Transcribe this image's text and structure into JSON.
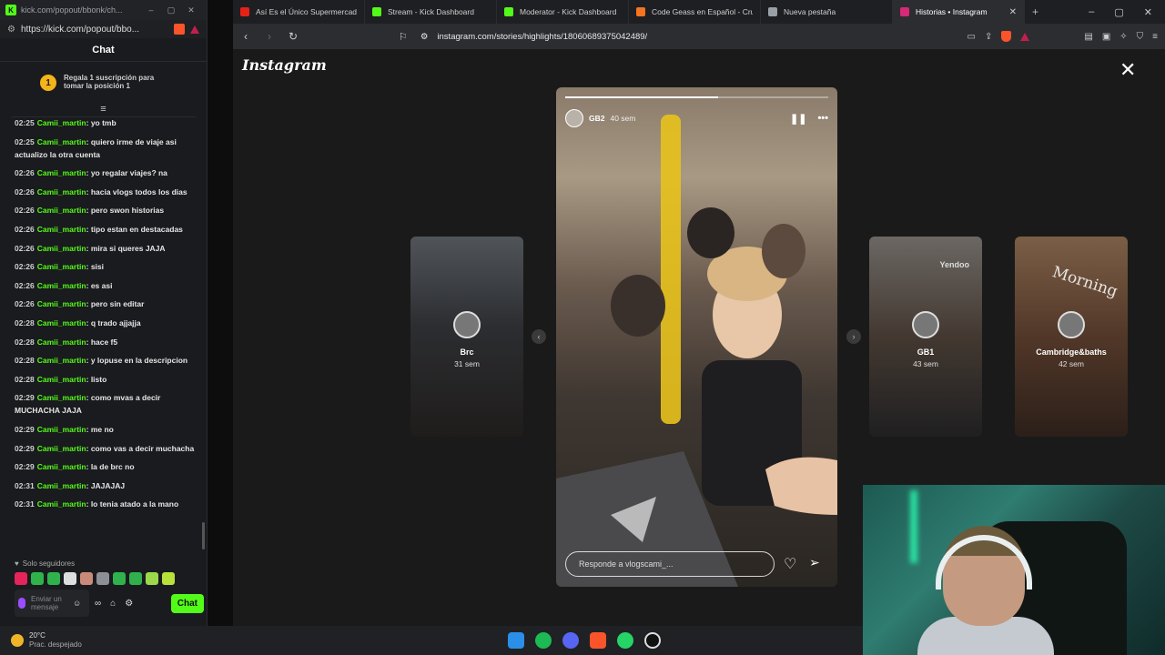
{
  "chat_window": {
    "title": "kick.com/popout/bbonk/ch...",
    "url": "https://kick.com/popout/bbo...",
    "header": "Chat",
    "promo": {
      "badge": "1",
      "text": "Regala 1 suscripción para tomar la posición 1"
    },
    "messages": [
      {
        "time": "02:25",
        "user": "Camii_martin",
        "text": "yo tmb"
      },
      {
        "time": "02:25",
        "user": "Camii_martin",
        "text": "quiero irme de viaje asi actualizo la otra cuenta"
      },
      {
        "time": "02:26",
        "user": "Camii_martin",
        "text": "yo regalar viajes? na"
      },
      {
        "time": "02:26",
        "user": "Camii_martin",
        "text": "hacia vlogs todos los dias"
      },
      {
        "time": "02:26",
        "user": "Camii_martin",
        "text": "pero swon historias"
      },
      {
        "time": "02:26",
        "user": "Camii_martin",
        "text": "tipo estan en destacadas"
      },
      {
        "time": "02:26",
        "user": "Camii_martin",
        "text": "mira si queres JAJA"
      },
      {
        "time": "02:26",
        "user": "Camii_martin",
        "text": "sisi"
      },
      {
        "time": "02:26",
        "user": "Camii_martin",
        "text": "es asi"
      },
      {
        "time": "02:26",
        "user": "Camii_martin",
        "text": "pero sin editar"
      },
      {
        "time": "02:28",
        "user": "Camii_martin",
        "text": "q trado ajjajja"
      },
      {
        "time": "02:28",
        "user": "Camii_martin",
        "text": "hace f5"
      },
      {
        "time": "02:28",
        "user": "Camii_martin",
        "text": "y lopuse en la descripcion"
      },
      {
        "time": "02:28",
        "user": "Camii_martin",
        "text": "listo"
      },
      {
        "time": "02:29",
        "user": "Camii_martin",
        "text": "como mvas a decir MUCHACHA JAJA"
      },
      {
        "time": "02:29",
        "user": "Camii_martin",
        "text": "me no"
      },
      {
        "time": "02:29",
        "user": "Camii_martin",
        "text": "como vas a decir muchacha"
      },
      {
        "time": "02:29",
        "user": "Camii_martin",
        "text": "la de brc no"
      },
      {
        "time": "02:31",
        "user": "Camii_martin",
        "text": "JAJAJAJ"
      },
      {
        "time": "02:31",
        "user": "Camii_martin",
        "text": "lo tenia atado a la mano"
      }
    ],
    "followers_only": "Solo seguidores",
    "input_placeholder": "Enviar un mensaje",
    "chat_button": "Chat"
  },
  "browser": {
    "tabs": [
      {
        "label": "Así Es el Único Supermercado P",
        "icon_color": "#e62117",
        "active": false
      },
      {
        "label": "Stream - Kick Dashboard",
        "icon_color": "#53fc18",
        "active": false
      },
      {
        "label": "Moderator - Kick Dashboard",
        "icon_color": "#53fc18",
        "active": false
      },
      {
        "label": "Code Geass en Español - Crunc",
        "icon_color": "#f47521",
        "active": false
      },
      {
        "label": "Nueva pestaña",
        "icon_color": "#9aa0a6",
        "active": false
      },
      {
        "label": "Historias • Instagram",
        "icon_color": "#d62976",
        "active": true
      }
    ],
    "url": "instagram.com/stories/highlights/18060689375042489/"
  },
  "instagram": {
    "logo": "Instagram",
    "current_story": {
      "user": "GB2",
      "time": "40 sem",
      "progress": 0.58,
      "reply_placeholder": "Responde a vlogscami_..."
    },
    "side_stories": [
      {
        "name": "Brc",
        "time": "31 sem",
        "overlay_text": ""
      },
      {
        "name": "GB1",
        "time": "43 sem",
        "overlay_text": "Yendoo"
      },
      {
        "name": "Cambridge&baths",
        "time": "42 sem",
        "overlay_text": "Morning"
      }
    ]
  },
  "taskbar": {
    "temperature": "20°C",
    "condition": "Prac. despejado"
  }
}
